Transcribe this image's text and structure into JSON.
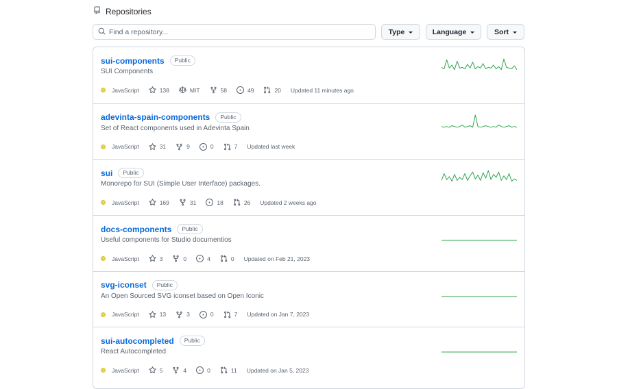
{
  "header": {
    "title": "Repositories",
    "icon": "repo-icon"
  },
  "search": {
    "placeholder": "Find a repository...",
    "value": ""
  },
  "filters": {
    "type_label": "Type",
    "language_label": "Language",
    "sort_label": "Sort"
  },
  "colors": {
    "link": "#0969da",
    "javascript": "#f1e05a",
    "spark": "#2da44e"
  },
  "repos": [
    {
      "name": "sui-components",
      "visibility": "Public",
      "description": "SUI Components",
      "language": "JavaScript",
      "stars": "138",
      "license": "MIT",
      "forks": "58",
      "issues": "49",
      "prs": "20",
      "updated": "Updated 11 minutes ago",
      "activity": [
        6,
        4,
        16,
        5,
        9,
        3,
        14,
        5,
        6,
        4,
        10,
        5,
        13,
        4,
        7,
        5,
        11,
        4,
        6,
        5,
        9,
        4,
        7,
        3,
        17,
        6,
        5,
        4,
        8,
        3
      ]
    },
    {
      "name": "adevinta-spain-components",
      "visibility": "Public",
      "description": "Set of React components used in Adevinta Spain",
      "language": "JavaScript",
      "stars": "31",
      "forks": "9",
      "issues": "0",
      "prs": "7",
      "updated": "Updated last week",
      "activity": [
        3,
        2,
        3,
        2,
        4,
        3,
        2,
        3,
        5,
        2,
        3,
        4,
        2,
        18,
        3,
        2,
        3,
        4,
        3,
        2,
        3,
        2,
        5,
        3,
        2,
        3,
        4,
        2,
        3,
        2
      ]
    },
    {
      "name": "sui",
      "visibility": "Public",
      "description": "Monorepo for SUI (Simple User Interface) packages.",
      "language": "JavaScript",
      "stars": "169",
      "forks": "31",
      "issues": "18",
      "prs": "26",
      "updated": "Updated 2 weeks ago",
      "activity": [
        5,
        14,
        6,
        10,
        4,
        13,
        5,
        9,
        6,
        14,
        5,
        11,
        16,
        7,
        12,
        5,
        15,
        8,
        18,
        6,
        13,
        9,
        16,
        5,
        11,
        6,
        14,
        4,
        7,
        5
      ]
    },
    {
      "name": "docs-components",
      "visibility": "Public",
      "description": "Useful components for Studio documentios",
      "language": "JavaScript",
      "stars": "3",
      "forks": "0",
      "issues": "4",
      "prs": "0",
      "updated": "Updated on Feb 21, 2023",
      "activity": [
        0,
        0,
        0,
        0,
        0,
        0,
        0,
        0,
        0,
        0,
        0,
        0,
        0,
        0,
        0,
        0,
        0,
        0,
        0,
        0,
        0,
        0,
        0,
        0,
        0,
        0,
        0,
        0,
        0,
        0
      ]
    },
    {
      "name": "svg-iconset",
      "visibility": "Public",
      "description": "An Open Sourced SVG iconset based on Open Iconic",
      "language": "JavaScript",
      "stars": "13",
      "forks": "3",
      "issues": "0",
      "prs": "7",
      "updated": "Updated on Jan 7, 2023",
      "activity": [
        0,
        0,
        0,
        0,
        0,
        0,
        0,
        0,
        0,
        0,
        0,
        0,
        0,
        0,
        0,
        0,
        0,
        0,
        0,
        0,
        0,
        0,
        0,
        0,
        0,
        0,
        0,
        0,
        0,
        0
      ]
    },
    {
      "name": "sui-autocompleted",
      "visibility": "Public",
      "description": "React Autocompleted",
      "language": "JavaScript",
      "stars": "5",
      "forks": "4",
      "issues": "0",
      "prs": "11",
      "updated": "Updated on Jan 5, 2023",
      "activity": [
        0,
        0,
        0,
        0,
        0,
        0,
        0,
        0,
        0,
        0,
        0,
        0,
        0,
        0,
        0,
        0,
        0,
        0,
        0,
        0,
        0,
        0,
        0,
        0,
        0,
        0,
        0,
        0,
        0,
        0
      ]
    }
  ]
}
